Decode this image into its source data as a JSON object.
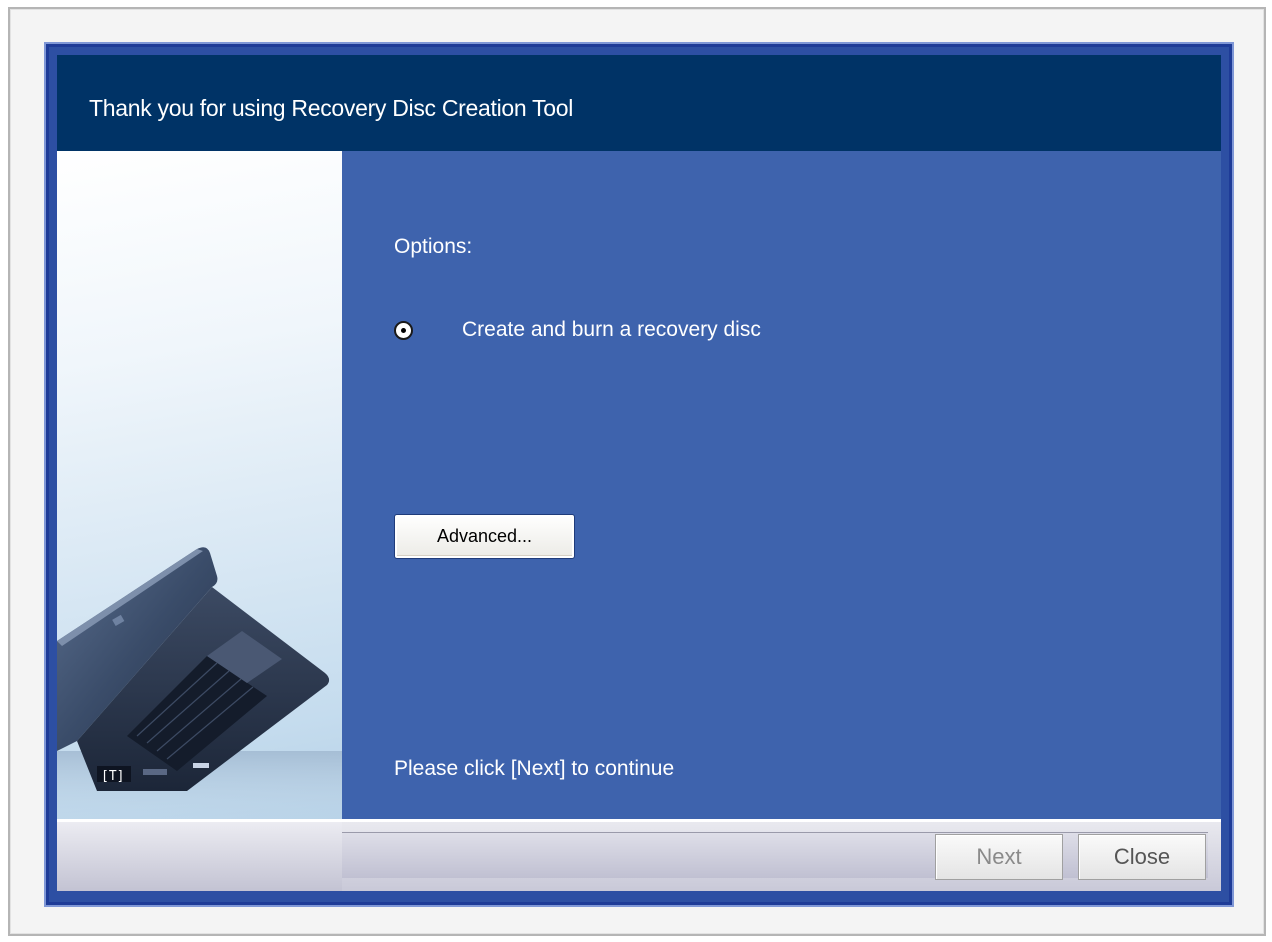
{
  "window": {
    "title": "Thank you for using Recovery Disc Creation Tool"
  },
  "main": {
    "options_label": "Options:",
    "radio_option": {
      "label": "Create and burn a recovery disc",
      "selected": true
    },
    "advanced_button": "Advanced...",
    "instruction": "Please click [Next] to continue"
  },
  "footer": {
    "next_button": "Next",
    "next_enabled": false,
    "close_button": "Close"
  },
  "colors": {
    "header_bg": "#003366",
    "content_bg": "#3e63ad",
    "border_blue": "#1e3b97"
  },
  "side_image": {
    "icon": "laptop-illustration"
  }
}
